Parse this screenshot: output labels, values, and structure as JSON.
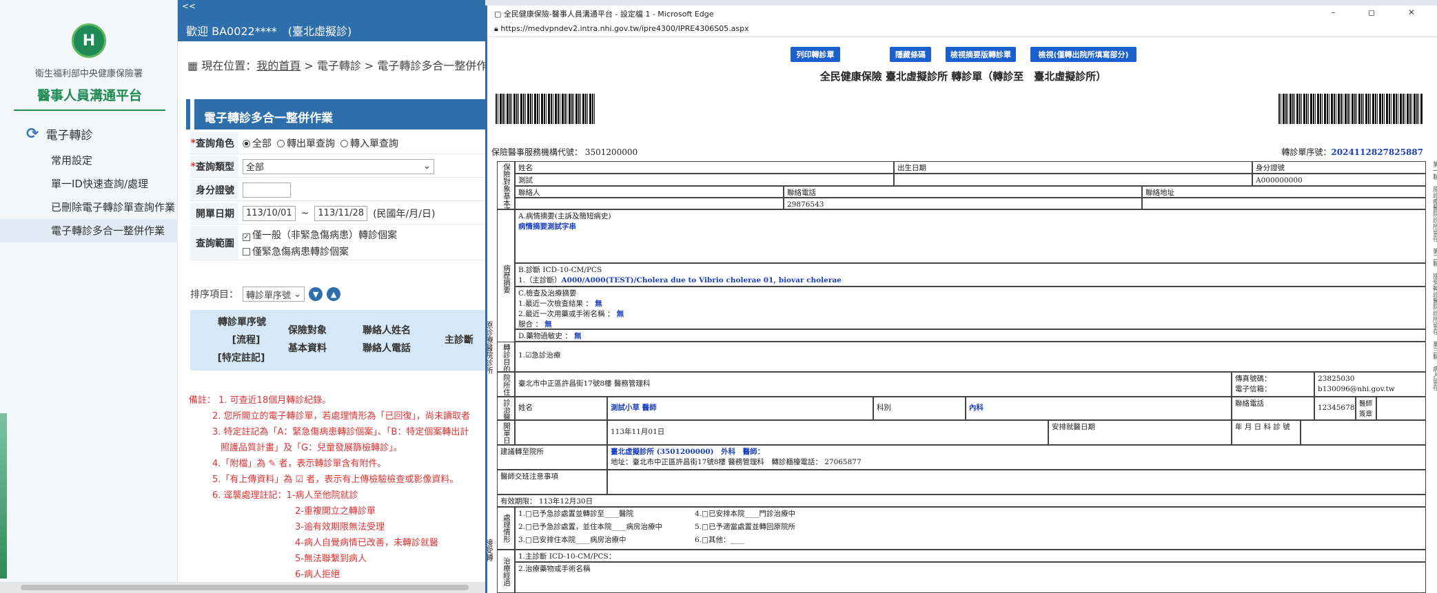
{
  "sidebar": {
    "logo_glyph": "H",
    "org_name": "衛生福利部中央健康保險署",
    "platform_title": "醫事人員溝通平台",
    "section": "電子轉診",
    "items": [
      "常用設定",
      "單一ID快速查詢/處理",
      "已刪除電子轉診單查詢作業",
      "電子轉診多合一整併作業"
    ]
  },
  "main": {
    "back_link": "<<",
    "welcome": "歡迎 BA0022****　(臺北虛擬診)",
    "breadcrumb_prefix": "現在位置：",
    "breadcrumb_home": "我的首頁",
    "breadcrumb_rest": " > 電子轉診 > 電子轉診多合一整併作業",
    "panel_title": "電子轉診多合一整併作業",
    "form": {
      "role_label": "查詢角色",
      "role_options": [
        "全部",
        "轉出單查詢",
        "轉入單查詢"
      ],
      "type_label": "查詢類型",
      "type_value": "全部",
      "id_label": "身分證號",
      "id_value": "",
      "date_label": "開單日期",
      "date_from": "113/10/01",
      "date_sep": "~",
      "date_to": "113/11/28",
      "date_hint": "(民國年/月/日)",
      "scope_label": "查詢範圍",
      "scope_opt1": "僅一般（非緊急傷病患）轉診個案",
      "scope_opt2": "僅緊急傷病患轉診個案"
    },
    "sort_label": "排序項目：",
    "sort_value": "轉診單序號",
    "table_headers": {
      "h1a": "轉診單序號",
      "h1b": "[流程]",
      "h1c": "[特定註記]",
      "h2a": "保險對象",
      "h2b": "基本資料",
      "h3a": "聯絡人姓名",
      "h3b": "聯絡人電話",
      "h4": "主診斷"
    },
    "notes": [
      "備註： 1. 可查近18個月轉診紀錄。",
      "2. 您所開立的電子轉診單，若處理情形為「已回復」，尚未讀取者",
      "3. 特定註記為「A：緊急傷病患轉診個案」、「B：特定個案轉出計",
      "照護品質計畫」及「G：兒童發展篩檢轉診」。",
      "4.「附檔」為 ✎ 者，表示轉診單含有附件。",
      "5.「有上傳資料」為 ☑ 者，表示有上傳檢驗檢查或影像資料。",
      "6. 逕襲處理註記：1-病人至他院就診",
      "2-重複開立之轉診單",
      "3-逾有效期限無法受理",
      "4-病人自覺病情已改善，未轉診就醫",
      "5-無法聯繫到病人",
      "6-病人拒絕"
    ]
  },
  "edge": {
    "title": "全民健康保險-醫事人員溝通平台 - 設定檔 1 - Microsoft Edge",
    "window_controls": "– ◻ ✕",
    "url": "https://medvpndev2.intra.nhi.gov.tw/ipre4300/IPRE4306S05.aspx",
    "buttons": [
      "列印轉診單",
      "隱藏條碼",
      "檢視摘要版轉診單",
      "檢視(僅轉出院所填寫部分)"
    ],
    "doc_title": "全民健康保險 臺北虛擬診所 轉診單（轉診至　臺北虛擬診所）",
    "org_code": "保險醫事服務機構代號： 3501200000",
    "serial_label": "轉診單序號：",
    "serial_value": "20241128278258​87",
    "form": {
      "s1_label": "保險對象基本資料",
      "name_label": "姓名",
      "name_value": "測試",
      "birth_label": "出生日期",
      "id_label": "身分證號",
      "id_value": "A000000000",
      "contact_label": "聯絡人",
      "contact_phone_label": "聯絡電話",
      "contact_phone_value": "29876543",
      "contact_addr_label": "聯絡地址",
      "s2_label": "病歷摘要",
      "a_label": "A.病情摘要(主訴及簡短病史)",
      "a_value": "病情摘要測試字串",
      "b_label": "B.診斷 ICD-10-CM/PCS",
      "b_value_prefix": "1.（主診斷）",
      "b_value": "A000/A000(TEST)/Cholera due to Vibrio cholerae 01, biovar cholerae",
      "c_label": "C.檢查及治療摘要",
      "c1": "1.最近一次檢查結果 ：",
      "c2": "2.最近一次用藥或手術名稱 ：",
      "c3": "服合 ：",
      "none_value": "無",
      "d_label": "D.藥物過敏史 ：",
      "purpose_label": "轉診目的",
      "purpose_value": "1.☑急診治療",
      "side_label": "原診療醫院診所",
      "addr_label": "院所住址",
      "addr_value": "臺北市中正區許昌街17號8樓 醫務管理科",
      "fax_label": "傳真號碼：",
      "fax_value": "23825030",
      "email_label": "電子信箱：",
      "email_value": "b130096@nhi.gov.tw",
      "doctor_label": "診治醫師",
      "doctor_name_label": "姓名",
      "doctor_name_value": "測試小草 醫師",
      "dept_label": "科別",
      "dept_value": "內科",
      "phone_label": "聯絡電話",
      "phone_value": "12345678",
      "license_label": "醫師簽章",
      "open_label": "開單日期",
      "open_value": "113年11月01日",
      "appt_label": "安排就醫日期",
      "appt_value": "年 月 日 科 診 號",
      "sugg_label": "建議轉至院所",
      "sugg_value1": "臺北虛擬診所 (3501200000)　外科　醫師：",
      "sugg_value2": "地址：臺北市中正區許昌街17號8樓 醫務管理科　轉診櫃檯電話： 27065877",
      "note_label": "醫師交班注意事項",
      "valid_label": "有效期限： 113年12月30日",
      "handle_label": "處理情形",
      "h1": "1.□已予急診處置並轉診至____醫院",
      "h2": "2.□已予急診處置，並住本院____病房治療中",
      "h3": "3.□已安排住本院____病房治療中",
      "h4": "4.□已安排本院____門診治療中",
      "h5": "5.□已予適當處置並轉回原院所",
      "h6": "6.□其他：____",
      "recv_label": "接受轉",
      "treat_label": "治療經過",
      "t1": "1.主診斷 ICD-10-CM/PCS：",
      "t2": "2.治療藥物或手術名稱"
    },
    "right_strip": "第一聯：原診療醫院診所留存，第二聯：接受轉診醫院診所留存，第三聯：病人留存"
  }
}
